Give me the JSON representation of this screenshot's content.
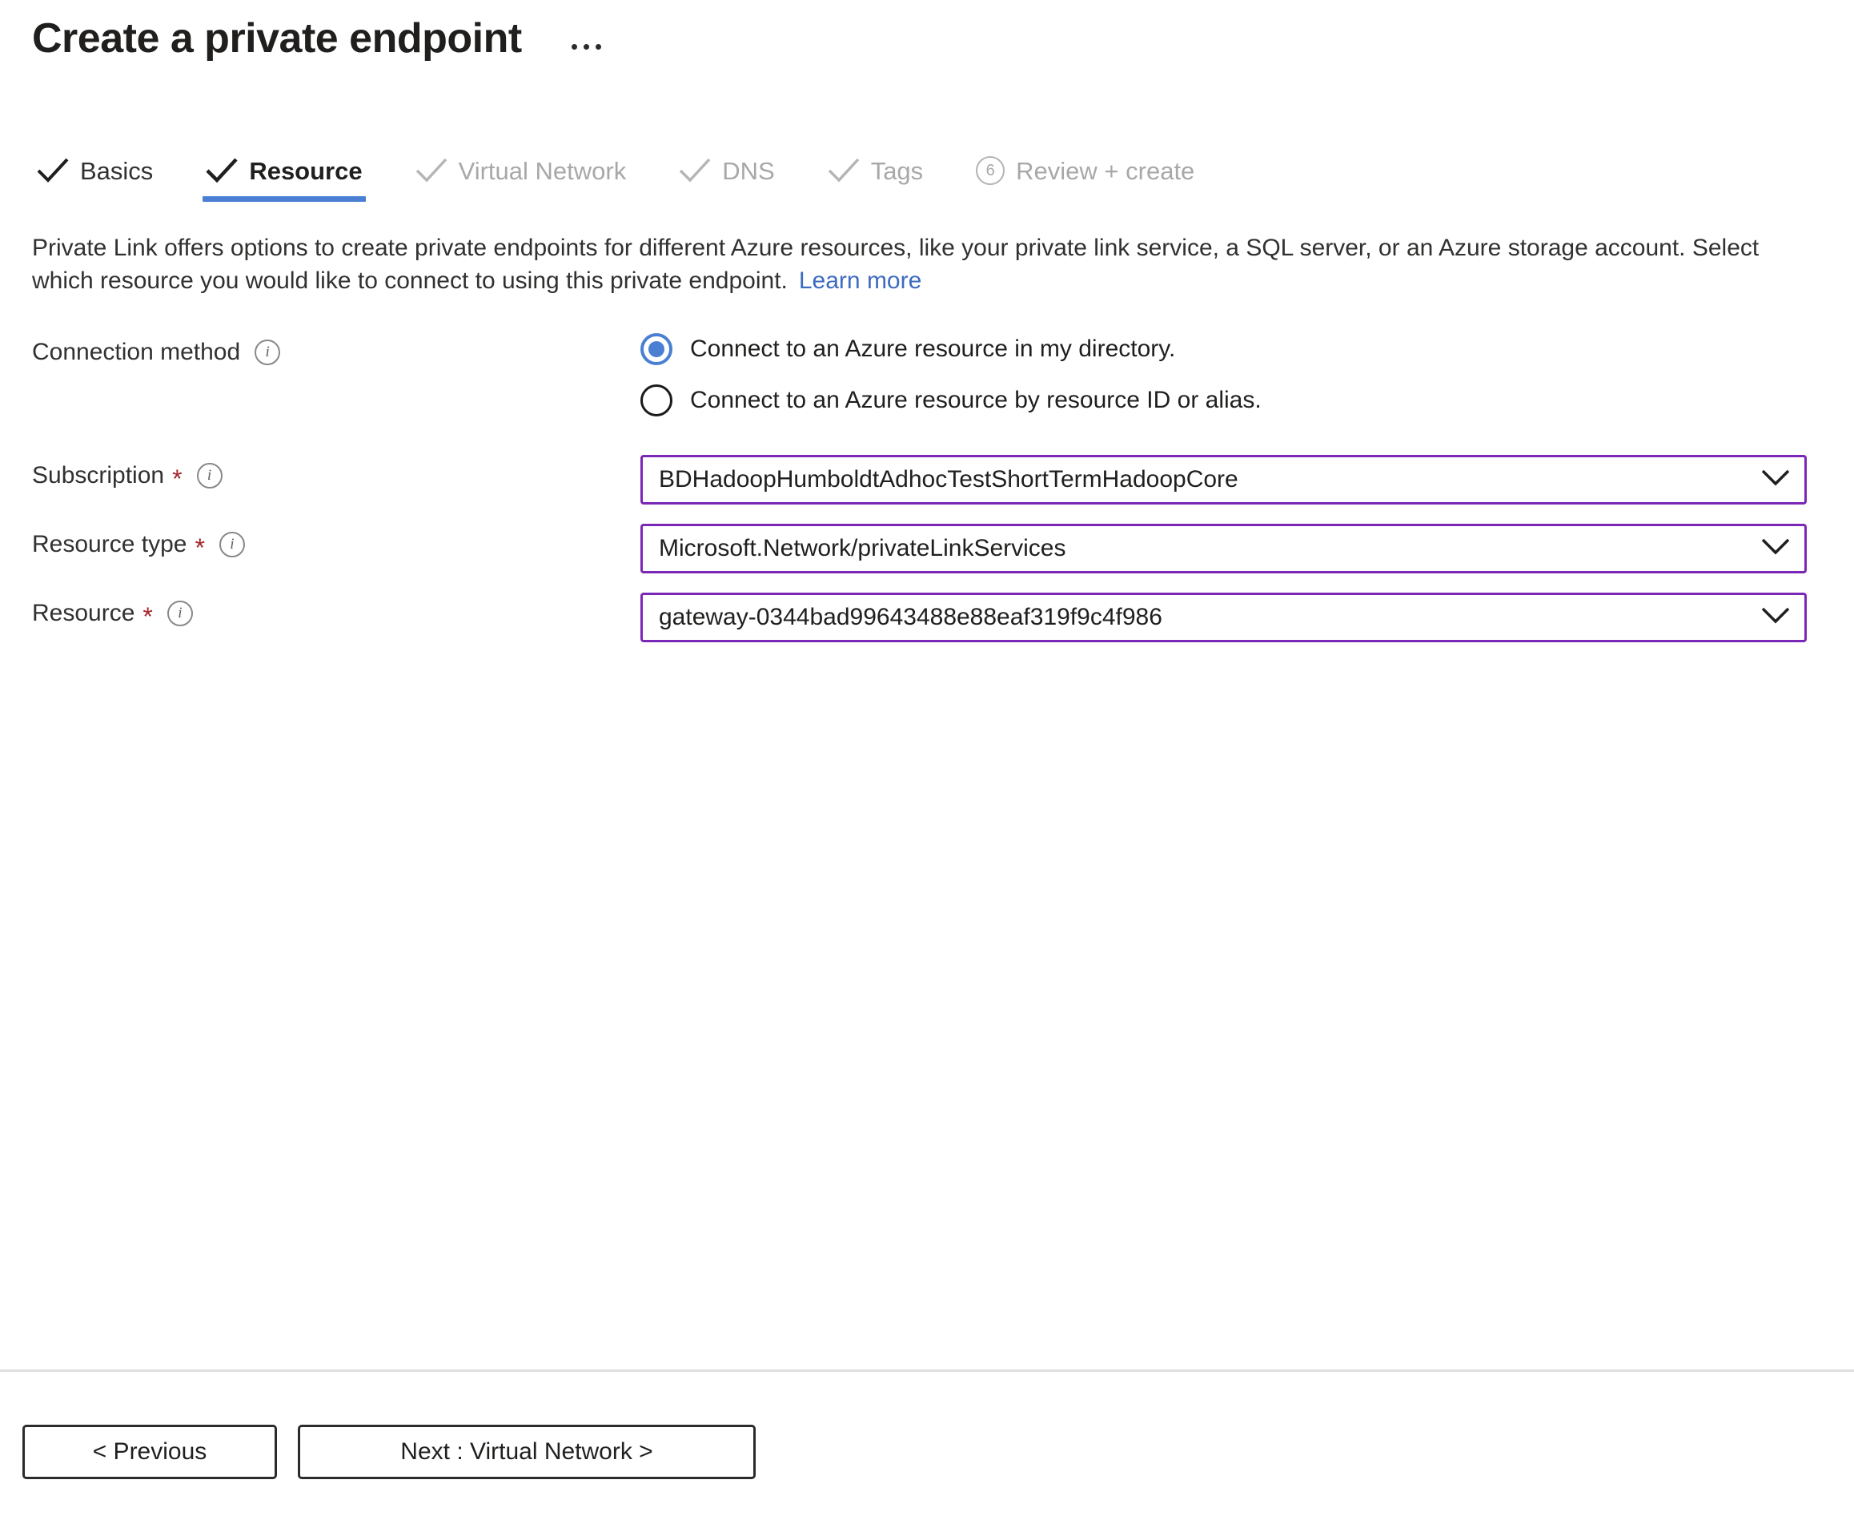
{
  "header": {
    "title": "Create a private endpoint",
    "more_menu_label": "..."
  },
  "tabs": [
    {
      "label": "Basics",
      "state": "done",
      "icon": "check-icon"
    },
    {
      "label": "Resource",
      "state": "active",
      "icon": "check-icon"
    },
    {
      "label": "Virtual Network",
      "state": "pending",
      "icon": "check-icon"
    },
    {
      "label": "DNS",
      "state": "pending",
      "icon": "check-icon"
    },
    {
      "label": "Tags",
      "state": "pending",
      "icon": "check-icon"
    },
    {
      "label": "Review + create",
      "state": "pending",
      "icon": "step-number",
      "step": "6"
    }
  ],
  "description": {
    "text": "Private Link offers options to create private endpoints for different Azure resources, like your private link service, a SQL server, or an Azure storage account. Select which resource you would like to connect to using this private endpoint.",
    "link_label": "Learn more"
  },
  "form": {
    "connection_method": {
      "label": "Connection method",
      "info_icon": "info-icon",
      "options": [
        {
          "label": "Connect to an Azure resource in my directory.",
          "selected": true
        },
        {
          "label": "Connect to an Azure resource by resource ID or alias.",
          "selected": false
        }
      ]
    },
    "subscription": {
      "label": "Subscription",
      "required": "*",
      "info_icon": "info-icon",
      "value": "BDHadoopHumboldtAdhocTestShortTermHadoopCore"
    },
    "resource_type": {
      "label": "Resource type",
      "required": "*",
      "info_icon": "info-icon",
      "value": "Microsoft.Network/privateLinkServices"
    },
    "resource": {
      "label": "Resource",
      "required": "*",
      "info_icon": "info-icon",
      "value": "gateway-0344bad99643488e88eaf319f9c4f986"
    }
  },
  "footer": {
    "previous_label": "< Previous",
    "next_label": "Next : Virtual Network >"
  },
  "colors": {
    "accent_tab_underline": "#4a7fd4",
    "radio_selected": "#4a7fd4",
    "dropdown_border": "#7b27b5",
    "required_star": "#a4262c",
    "link": "#3e6bbf",
    "pending_tab_text": "#a8a8a8"
  }
}
